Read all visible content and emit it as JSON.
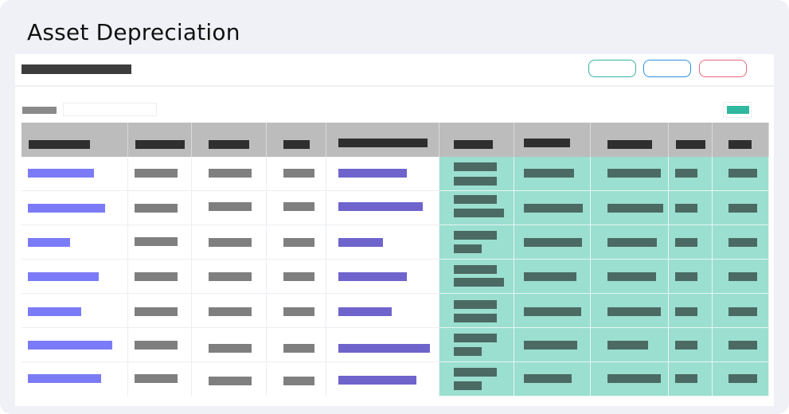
{
  "page": {
    "title": "Asset Depreciation"
  },
  "colors": {
    "background": "#f0f1f6",
    "header_row": "#bcbcbc",
    "highlight_cells": "#9bdfd0",
    "link_bar": "#7b7bf7",
    "secondary_link_bar": "#6e64cc",
    "button_teal": "#36b3a2",
    "button_blue": "#2d8fe0",
    "button_red": "#e9667d",
    "add_button": "#30b89e"
  },
  "icons": []
}
